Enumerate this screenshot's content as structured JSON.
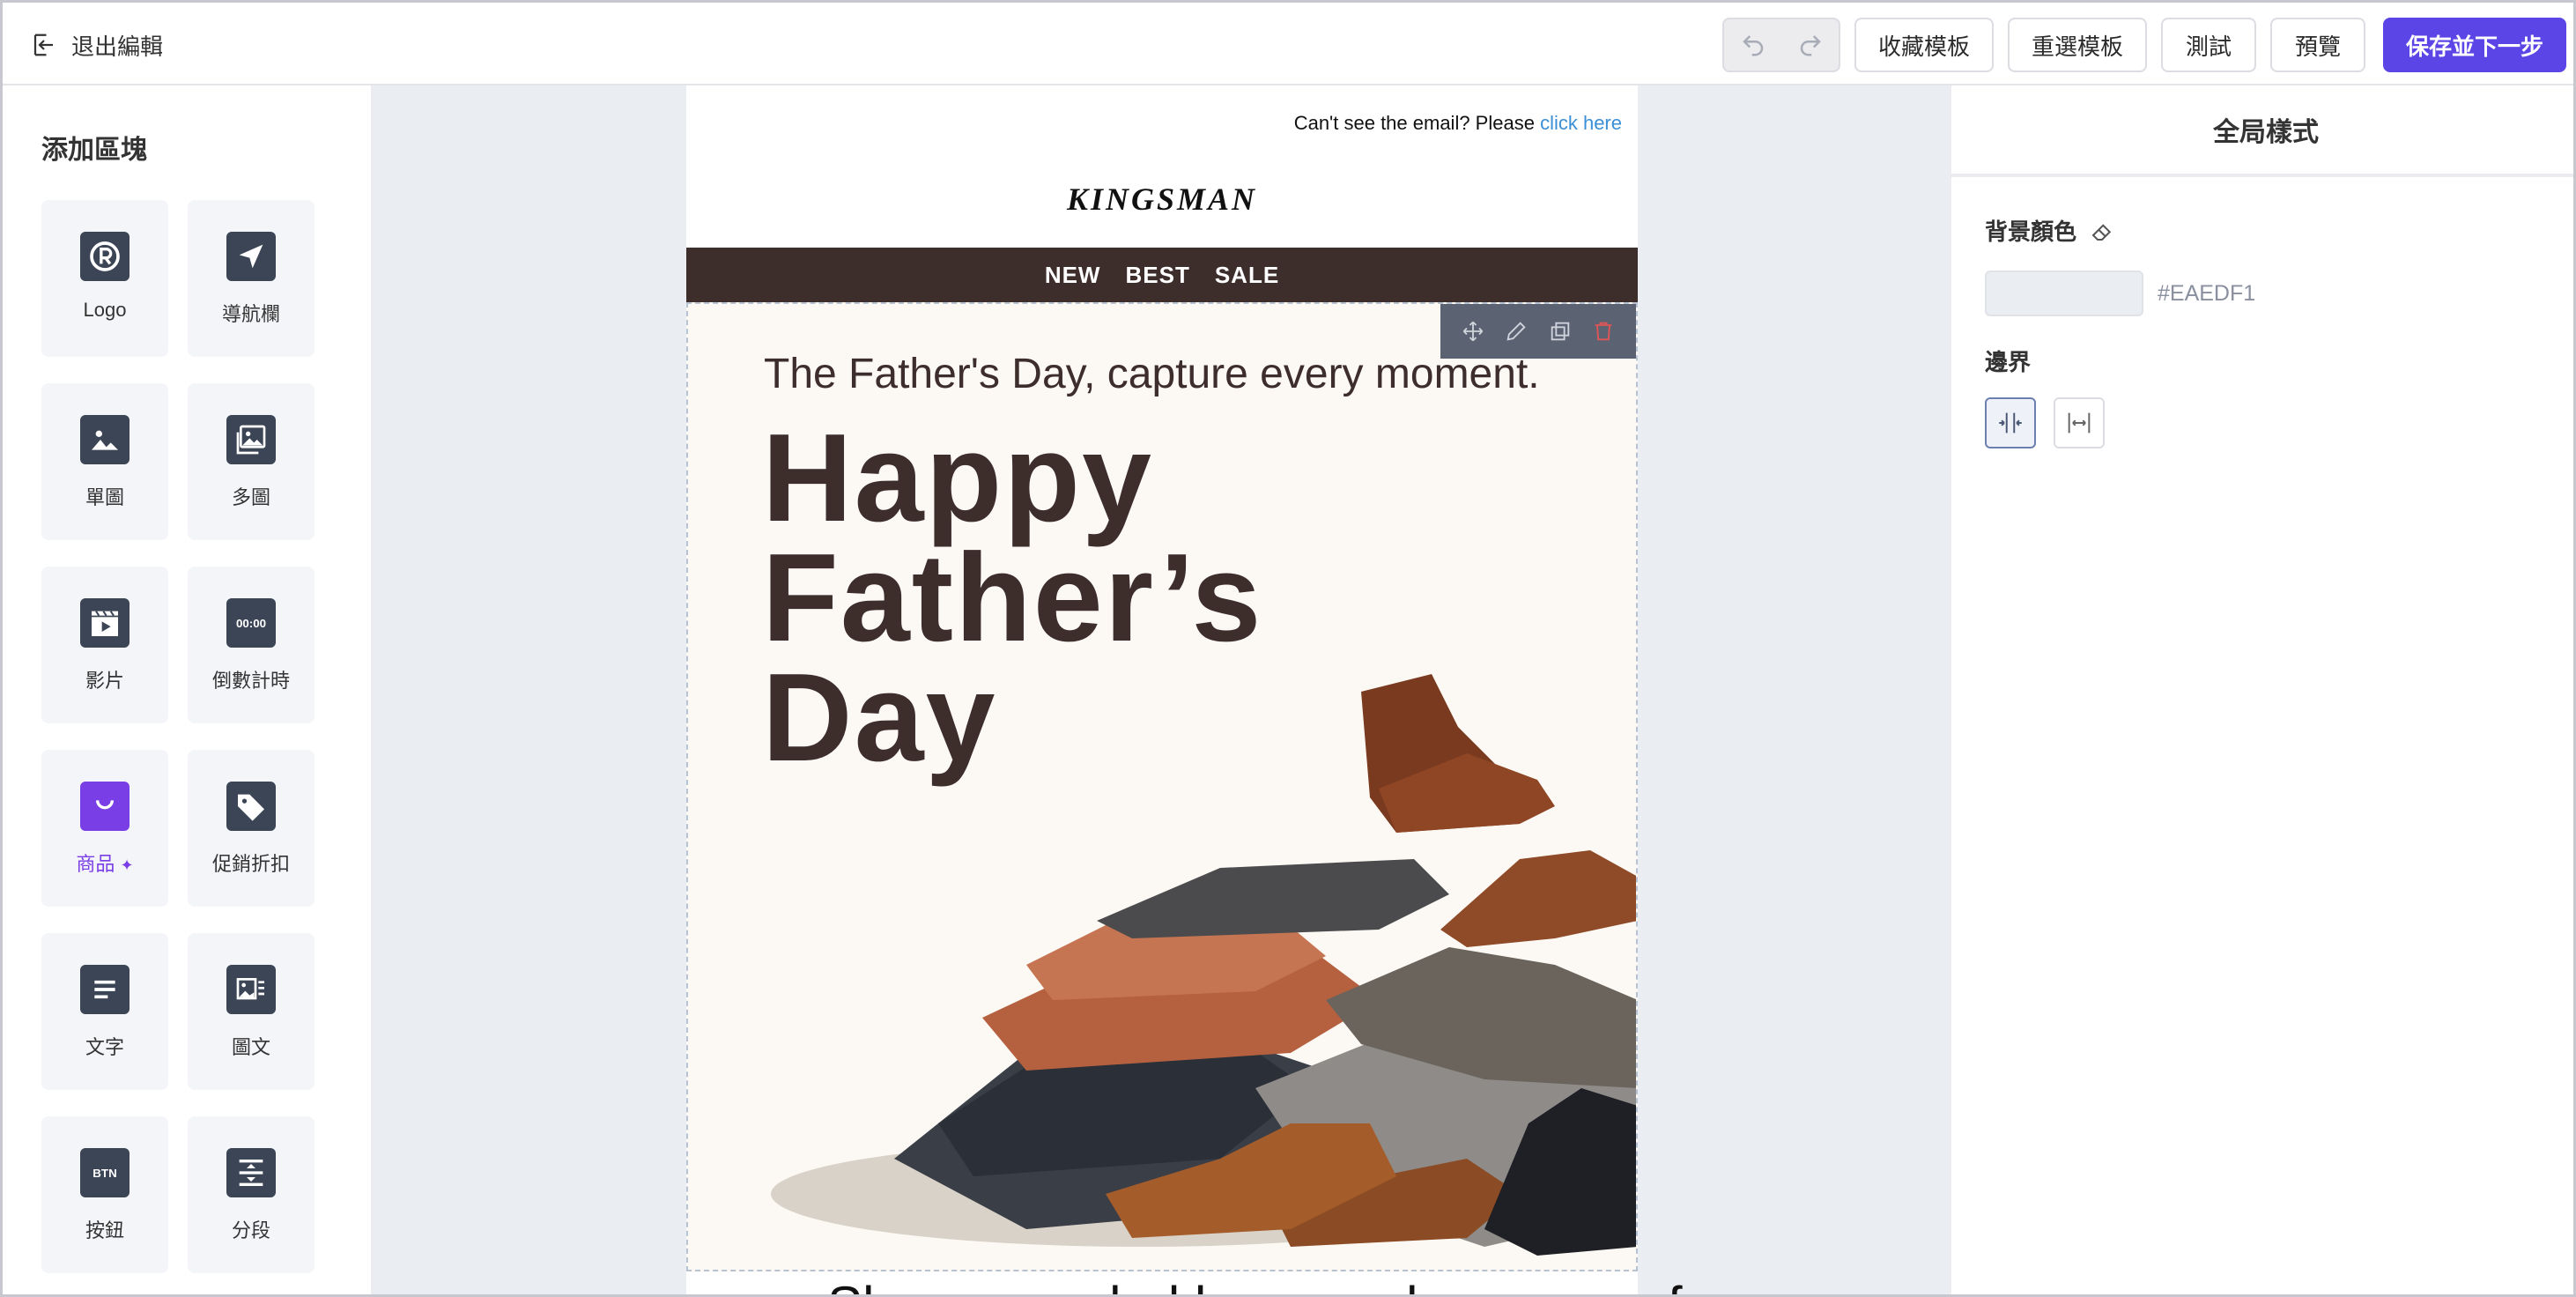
{
  "topbar": {
    "exit_label": "退出編輯",
    "buttons": {
      "save_template": "收藏模板",
      "reset_template": "重選模板",
      "test": "測試",
      "preview": "預覽",
      "save_next": "保存並下一步"
    }
  },
  "left_panel": {
    "title": "添加區塊",
    "blocks": [
      {
        "label": "Logo",
        "icon": "logo-icon"
      },
      {
        "label": "導航欄",
        "icon": "navigation-icon"
      },
      {
        "label": "單圖",
        "icon": "image-icon"
      },
      {
        "label": "多圖",
        "icon": "images-icon"
      },
      {
        "label": "影片",
        "icon": "video-icon"
      },
      {
        "label": "倒數計時",
        "icon": "countdown-icon"
      },
      {
        "label": "商品",
        "icon": "shopping-bag-icon"
      },
      {
        "label": "促銷折扣",
        "icon": "tag-icon"
      },
      {
        "label": "文字",
        "icon": "text-icon"
      },
      {
        "label": "圖文",
        "icon": "image-text-icon"
      },
      {
        "label": "按鈕",
        "icon": "button-icon"
      },
      {
        "label": "分段",
        "icon": "divider-icon"
      }
    ],
    "active_block": "商品"
  },
  "email": {
    "cant_see_prefix": "Can't see the email? Please ",
    "cant_see_link": "click here",
    "logo_text": "KINGSMAN",
    "nav": [
      "NEW",
      "BEST",
      "SALE"
    ],
    "hero_tagline": "The Father's Day, capture every moment.",
    "hero_title_lines": [
      "Happy",
      "Father’s",
      "Day"
    ],
    "next_text": "Show your dad how much you care for"
  },
  "right_panel": {
    "title": "全局樣式",
    "bg_color_label": "背景顏色",
    "bg_color_value": "#EAEDF1",
    "border_label": "邊界"
  },
  "colors": {
    "accent": "#5b45e6",
    "nav_bg": "#3d2e2c",
    "canvas_bg": "#EAEDF1"
  }
}
